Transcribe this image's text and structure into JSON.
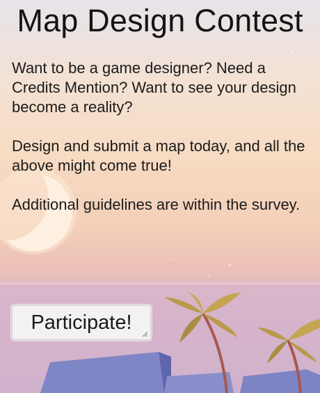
{
  "page": {
    "title": "Map Design Contest",
    "paragraphs": [
      "Want to be a game designer? Need a Credits Mention? Want to see your design become a reality?",
      "Design and submit a map today, and all the above might come true!",
      "Additional guidelines are within the survey."
    ],
    "cta_label": "Participate!"
  },
  "colors": {
    "sky_top": "#e6e3ea",
    "sky_mid": "#f7dbc2",
    "sea": "#d7b3c9",
    "rock": "#7f86c6",
    "palm_leaf": "#b89a4a",
    "palm_trunk": "#a8574e"
  },
  "icons": [
    "moon-icon",
    "palm-tree-icon",
    "resize-grip-icon"
  ]
}
